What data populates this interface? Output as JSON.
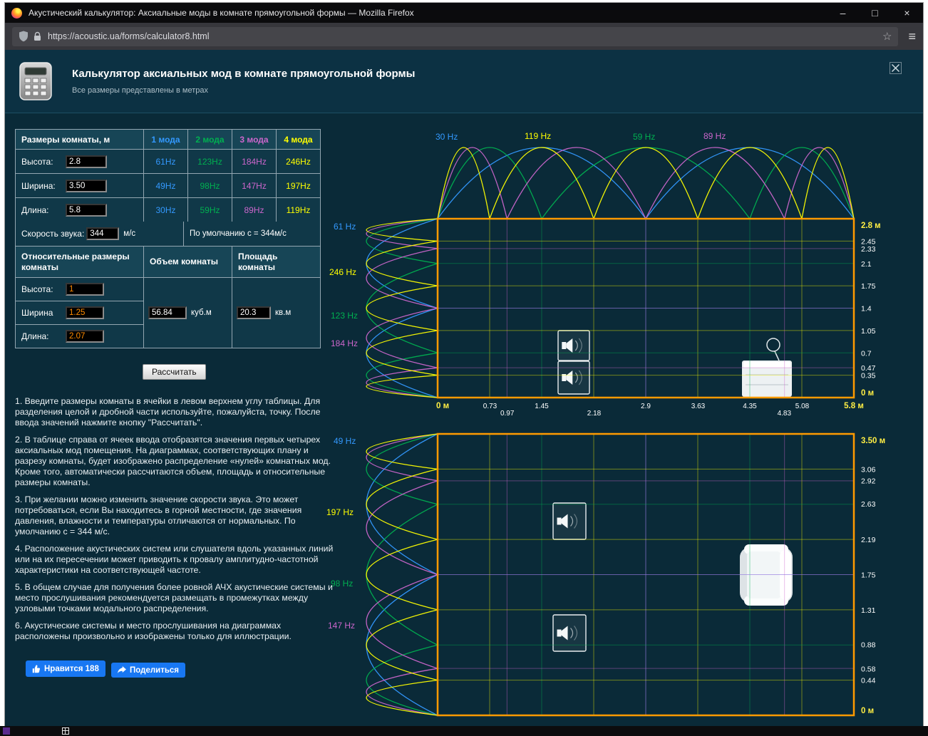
{
  "browser": {
    "title": "Акустический калькулятор: Аксиальные моды в комнате прямоугольной формы — Mozilla Firefox",
    "url": "https://acoustic.ua/forms/calculator8.html",
    "star_icon": "☆",
    "menu_icon": "≡"
  },
  "header": {
    "title": "Калькулятор аксиальных мод в комнате прямоугольной формы",
    "subtitle": "Все размеры представлены в метрах"
  },
  "colors": {
    "mode1": "#3399ff",
    "mode2": "#00b050",
    "mode3": "#cc66cc",
    "mode4": "#ffff00",
    "room_outline": "#ff9a00",
    "accent_yellow": "#ffee44",
    "link_blue": "#1877f2"
  },
  "dim_table": {
    "title": "Размеры комнаты, м",
    "mode_headers": [
      "1 мода",
      "2 мода",
      "3 мода",
      "4 мода"
    ],
    "rows": [
      {
        "label": "Высота:",
        "value": "2.8",
        "modes": [
          "61Hz",
          "123Hz",
          "184Hz",
          "246Hz"
        ]
      },
      {
        "label": "Ширина:",
        "value": "3.50",
        "modes": [
          "49Hz",
          "98Hz",
          "147Hz",
          "197Hz"
        ]
      },
      {
        "label": "Длина:",
        "value": "5.8",
        "modes": [
          "30Hz",
          "59Hz",
          "89Hz",
          "119Hz"
        ]
      }
    ],
    "speed_label": "Скорость звука:",
    "speed_value": "344",
    "speed_unit": "м/с",
    "speed_note": "По  умолчанию с = 344м/с"
  },
  "rel_table": {
    "headers": [
      "Относительные размеры комнаты",
      "Объем комнаты",
      "Площадь комнаты"
    ],
    "rows": [
      {
        "label": "Высота:",
        "value": "1"
      },
      {
        "label": "Ширина",
        "value": "1.25"
      },
      {
        "label": "Длина:",
        "value": "2.07"
      }
    ],
    "volume_value": "56.84",
    "volume_unit": "куб.м",
    "area_value": "20.3",
    "area_unit": "кв.м"
  },
  "calculate_label": "Рассчитать",
  "instructions": [
    "1. Введите размеры комнаты в ячейки в левом верхнем углу таблицы. Для разделения целой и дробной части используйте, пожалуйста, точку. После ввода значений нажмите кнопку \"Рассчитать\".",
    "2. В таблице справа от ячеек ввода отобразятся значения первых четырех аксиальных мод помещения. На диаграммах, соответствующих плану и разрезу комнаты, будет изображено распределение «нулей» комнатных мод. Кроме того, автоматически рассчитаются объем, площадь и относительные размеры комнаты.",
    "3. При желании можно изменить значение скорости звука. Это может потребоваться, если Вы находитесь в горной местности, где значения давления, влажности и температуры отличаются от нормальных. По умолчанию с = 344 м/с.",
    "4. Расположение акустических систем или слушателя вдоль указанных линий или на их пересечении может приводить к провалу амплитудно-частотной характеристики на соответствующей частоте.",
    "5. В общем случае для получения более ровной АЧХ акустические системы и место прослушивания рекомендуется размещать в промежутках между узловыми точками модального распределения.",
    "6. Акустические системы и место прослушивания на диаграммах расположены произвольно и изображены только для иллюстрации."
  ],
  "social": {
    "like_label": "Нравится 188",
    "share_label": "Поделиться"
  },
  "diagrams": {
    "section": {
      "length_m": 5.8,
      "side_m": 2.8,
      "length_modes": [
        {
          "mode": 1,
          "freq": "30 Hz"
        },
        {
          "mode": 2,
          "freq": "59 Hz"
        },
        {
          "mode": 3,
          "freq": "89 Hz"
        },
        {
          "mode": 4,
          "freq": "119 Hz"
        }
      ],
      "side_modes": [
        {
          "mode": 1,
          "freq": "61 Hz"
        },
        {
          "mode": 2,
          "freq": "123 Hz"
        },
        {
          "mode": 3,
          "freq": "184 Hz"
        },
        {
          "mode": 4,
          "freq": "246 Hz"
        }
      ],
      "bottom_ticks": [
        {
          "label": "0 м",
          "m": 0,
          "row": 0,
          "end": true
        },
        {
          "label": "0.73",
          "m": 0.73,
          "row": 0
        },
        {
          "label": "0.97",
          "m": 0.97,
          "row": 1
        },
        {
          "label": "1.45",
          "m": 1.45,
          "row": 0
        },
        {
          "label": "2.18",
          "m": 2.18,
          "row": 1
        },
        {
          "label": "2.9",
          "m": 2.9,
          "row": 0
        },
        {
          "label": "3.63",
          "m": 3.63,
          "row": 0
        },
        {
          "label": "4.35",
          "m": 4.35,
          "row": 0
        },
        {
          "label": "4.83",
          "m": 4.83,
          "row": 1
        },
        {
          "label": "5.08",
          "m": 5.08,
          "row": 0
        },
        {
          "label": "5.8 м",
          "m": 5.8,
          "row": 0,
          "end": true
        }
      ],
      "right_ticks": [
        {
          "label": "2.8 м",
          "m": 2.8,
          "end": true
        },
        {
          "label": "2.45",
          "m": 2.45
        },
        {
          "label": "2.33",
          "m": 2.33
        },
        {
          "label": "2.1",
          "m": 2.1
        },
        {
          "label": "1.75",
          "m": 1.75
        },
        {
          "label": "1.4",
          "m": 1.4
        },
        {
          "label": "1.05",
          "m": 1.05
        },
        {
          "label": "0.7",
          "m": 0.7
        },
        {
          "label": "0.47",
          "m": 0.47
        },
        {
          "label": "0.35",
          "m": 0.35
        },
        {
          "label": "0 м",
          "m": 0,
          "end": true
        }
      ]
    },
    "plan": {
      "length_m": 5.8,
      "side_m": 3.5,
      "side_modes": [
        {
          "mode": 1,
          "freq": "49 Hz"
        },
        {
          "mode": 2,
          "freq": "98 Hz"
        },
        {
          "mode": 3,
          "freq": "147 Hz"
        },
        {
          "mode": 4,
          "freq": "197 Hz"
        }
      ],
      "right_ticks": [
        {
          "label": "3.50 м",
          "m": 3.5,
          "end": true
        },
        {
          "label": "3.06",
          "m": 3.06
        },
        {
          "label": "2.92",
          "m": 2.92
        },
        {
          "label": "2.63",
          "m": 2.63
        },
        {
          "label": "2.19",
          "m": 2.19
        },
        {
          "label": "1.75",
          "m": 1.75
        },
        {
          "label": "1.31",
          "m": 1.31
        },
        {
          "label": "0.88",
          "m": 0.88
        },
        {
          "label": "0.58",
          "m": 0.58
        },
        {
          "label": "0.44",
          "m": 0.44
        },
        {
          "label": "0 м",
          "m": 0,
          "end": true
        }
      ]
    }
  }
}
